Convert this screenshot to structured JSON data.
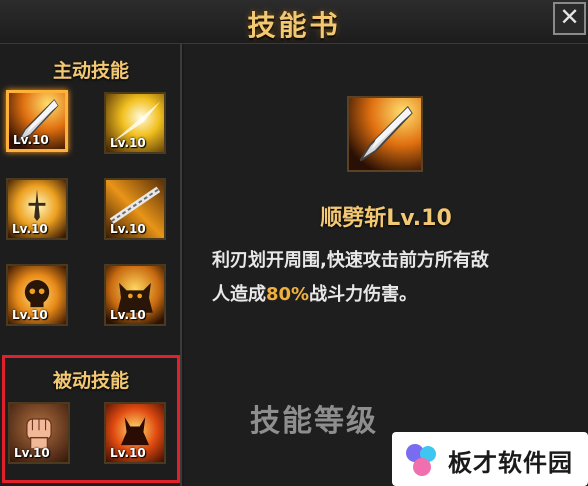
{
  "window": {
    "title": "技能书",
    "close_icon": "close-icon"
  },
  "active_section": {
    "label": "主动技能",
    "skills": [
      {
        "level": "Lv.10",
        "icon": "blade-icon",
        "selected": true
      },
      {
        "level": "Lv.10",
        "icon": "light-slash-icon"
      },
      {
        "level": "Lv.10",
        "icon": "sword-aura-icon"
      },
      {
        "level": "Lv.10",
        "icon": "chain-blades-icon"
      },
      {
        "level": "Lv.10",
        "icon": "skull-explosion-icon"
      },
      {
        "level": "Lv.10",
        "icon": "demon-icon"
      }
    ]
  },
  "passive_section": {
    "label": "被动技能",
    "skills": [
      {
        "level": "Lv.10",
        "icon": "fist-icon"
      },
      {
        "level": "Lv.10",
        "icon": "rage-icon"
      }
    ]
  },
  "detail": {
    "icon": "blade-icon",
    "name": "顺劈斩Lv.10",
    "desc_line1": "利刃划开周围,快速攻击前方所有敌",
    "desc_line2_pre": "人造成",
    "desc_highlight": "80%",
    "desc_line2_post": "战斗力伤害。",
    "faded_text": "技能等级"
  },
  "watermark": {
    "text": "板才软件园"
  }
}
